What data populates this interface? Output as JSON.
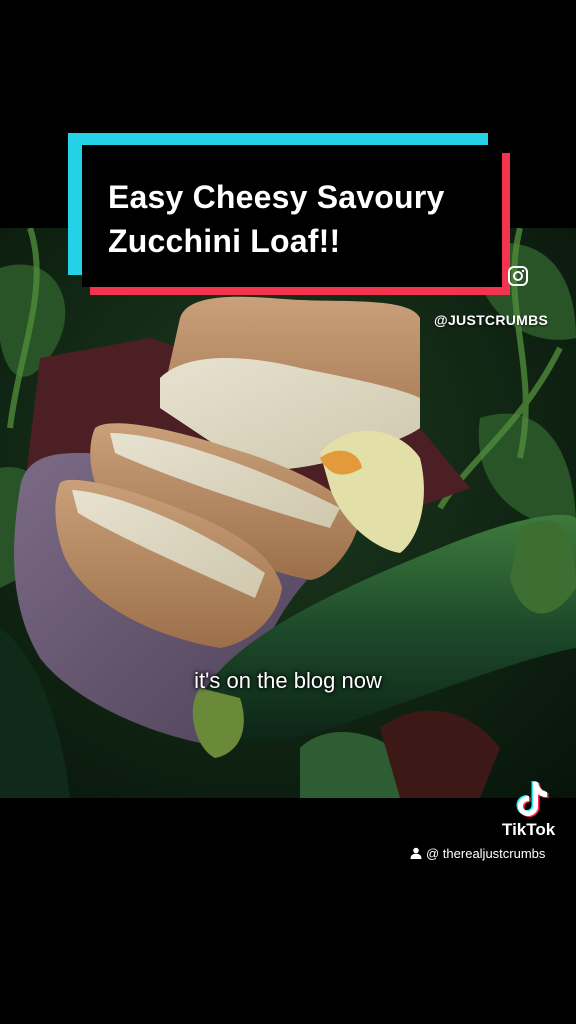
{
  "title": {
    "line1": "Easy Cheesy Savoury",
    "line2": "Zucchini Loaf!!"
  },
  "watermark_handle": "@JUSTCRUMBS",
  "caption": "it's on the blog now",
  "tiktok": {
    "wordmark": "TikTok",
    "username": "@ therealjustcrumbs",
    "icons": [
      "tiktok-logo-icon",
      "person-icon",
      "instagram-icon"
    ]
  },
  "colors": {
    "background": "#000000",
    "title_cyan": "#25d1e6",
    "title_red": "#f2344f",
    "zucchini": "#1f4a2c"
  }
}
